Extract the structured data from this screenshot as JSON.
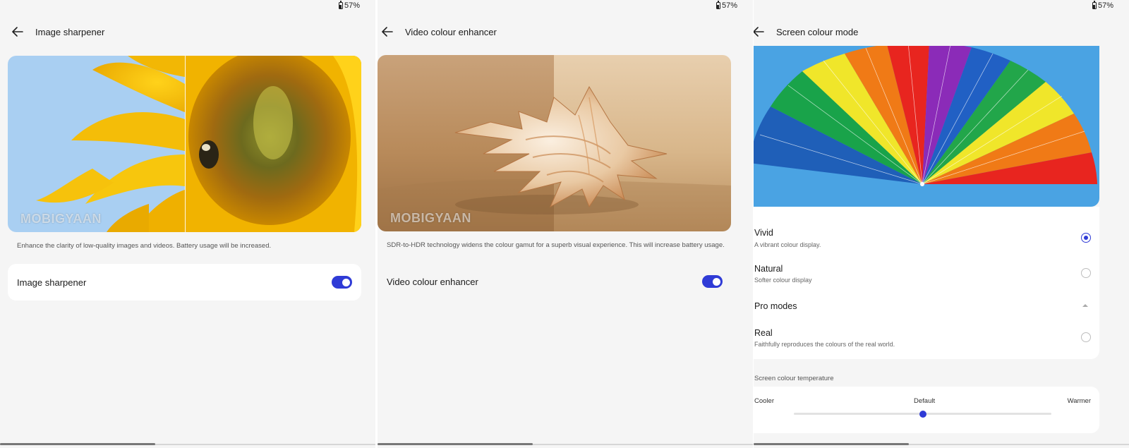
{
  "status": {
    "battery": "57%"
  },
  "watermark": "MOBIGYAAN",
  "screens": [
    {
      "title": "Image sharpener",
      "description": "Enhance the clarity of low-quality images and videos. Battery usage will be increased.",
      "setting": {
        "label": "Image sharpener",
        "enabled": true
      }
    },
    {
      "title": "Video colour enhancer",
      "description": "SDR-to-HDR technology widens the colour gamut for a superb visual experience. This will increase battery usage.",
      "setting": {
        "label": "Video colour enhancer",
        "enabled": true
      }
    },
    {
      "title": "Screen colour mode",
      "options": [
        {
          "title": "Vivid",
          "subtitle": "A vibrant colour display.",
          "selected": true
        },
        {
          "title": "Natural",
          "subtitle": "Softer colour display",
          "selected": false
        }
      ],
      "pro_modes": {
        "label": "Pro modes",
        "expanded": true,
        "options": [
          {
            "title": "Real",
            "subtitle": "Faithfully reproduces the colours of the real world.",
            "selected": false
          }
        ]
      },
      "temperature": {
        "section_label": "Screen colour temperature",
        "left_label": "Cooler",
        "center_label": "Default",
        "right_label": "Warmer",
        "value": 0.5
      }
    }
  ],
  "colors": {
    "accent": "#2f3bd6",
    "background": "#f5f5f5",
    "card": "#ffffff"
  }
}
